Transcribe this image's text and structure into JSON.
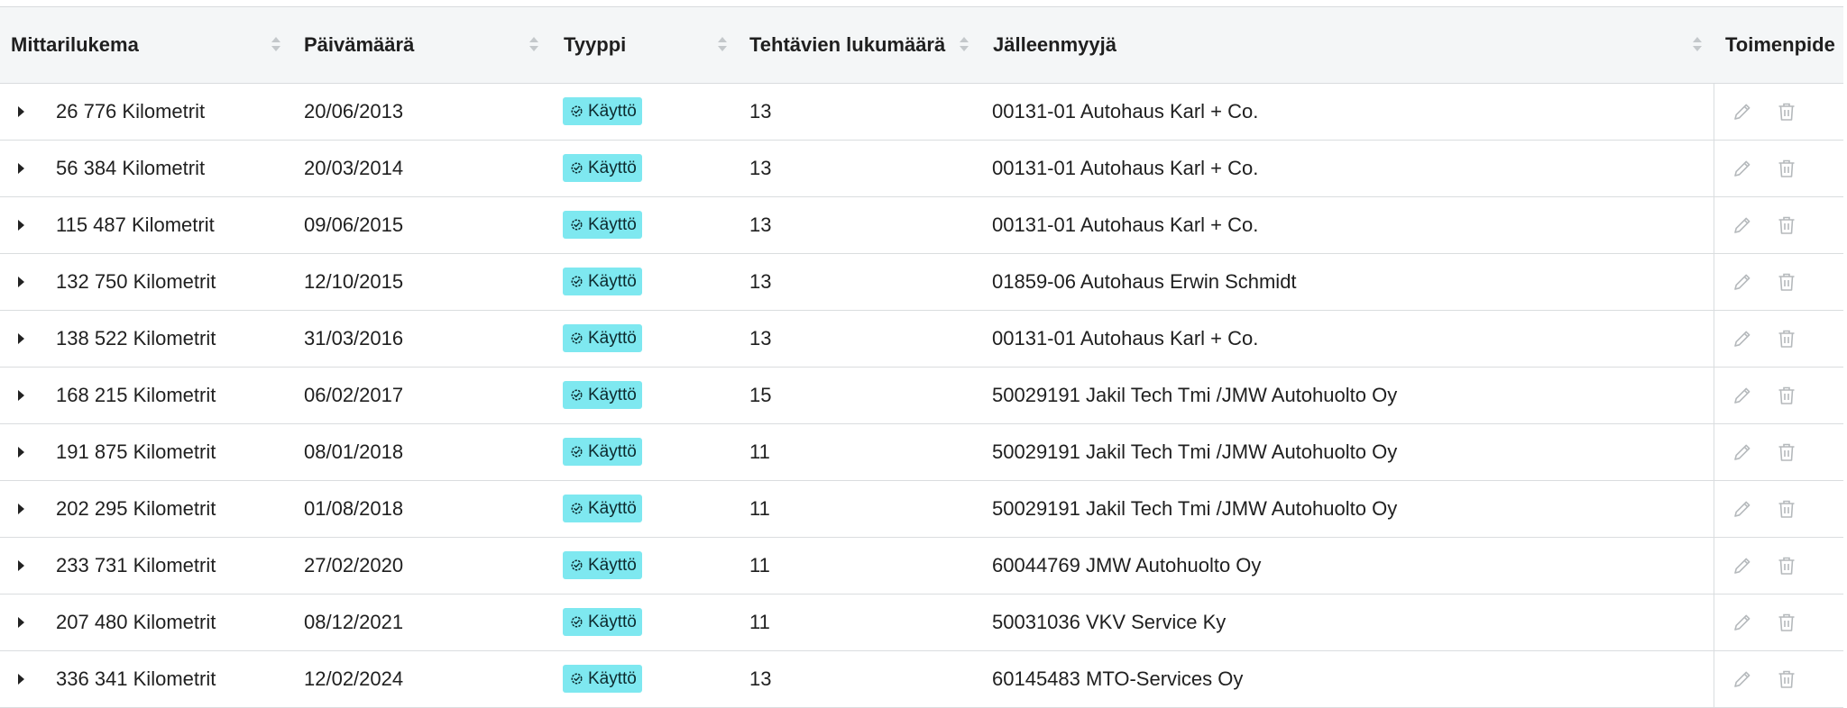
{
  "table": {
    "columns": [
      {
        "label": "Mittarilukema"
      },
      {
        "label": "Päivämäärä"
      },
      {
        "label": "Tyyppi"
      },
      {
        "label": "Tehtävien lukumäärä"
      },
      {
        "label": "Jälleenmyyjä"
      },
      {
        "label": "Toimenpide"
      }
    ],
    "rows": [
      {
        "mileage": "26 776 Kilometrit",
        "date": "20/06/2013",
        "type": "Käyttö",
        "tasks": "13",
        "dealer": "00131-01 Autohaus Karl + Co."
      },
      {
        "mileage": "56 384 Kilometrit",
        "date": "20/03/2014",
        "type": "Käyttö",
        "tasks": "13",
        "dealer": "00131-01 Autohaus Karl + Co."
      },
      {
        "mileage": "115 487 Kilometrit",
        "date": "09/06/2015",
        "type": "Käyttö",
        "tasks": "13",
        "dealer": "00131-01 Autohaus Karl + Co."
      },
      {
        "mileage": "132 750 Kilometrit",
        "date": "12/10/2015",
        "type": "Käyttö",
        "tasks": "13",
        "dealer": "01859-06 Autohaus Erwin Schmidt"
      },
      {
        "mileage": "138 522 Kilometrit",
        "date": "31/03/2016",
        "type": "Käyttö",
        "tasks": "13",
        "dealer": "00131-01 Autohaus Karl + Co."
      },
      {
        "mileage": "168 215 Kilometrit",
        "date": "06/02/2017",
        "type": "Käyttö",
        "tasks": "15",
        "dealer": "50029191 Jakil Tech Tmi /JMW Autohuolto Oy"
      },
      {
        "mileage": "191 875 Kilometrit",
        "date": "08/01/2018",
        "type": "Käyttö",
        "tasks": "11",
        "dealer": "50029191 Jakil Tech Tmi /JMW Autohuolto Oy"
      },
      {
        "mileage": "202 295 Kilometrit",
        "date": "01/08/2018",
        "type": "Käyttö",
        "tasks": "11",
        "dealer": "50029191 Jakil Tech Tmi /JMW Autohuolto Oy"
      },
      {
        "mileage": "233 731 Kilometrit",
        "date": "27/02/2020",
        "type": "Käyttö",
        "tasks": "11",
        "dealer": "60044769 JMW Autohuolto Oy"
      },
      {
        "mileage": "207 480 Kilometrit",
        "date": "08/12/2021",
        "type": "Käyttö",
        "tasks": "11",
        "dealer": "50031036 VKV Service Ky"
      },
      {
        "mileage": "336 341 Kilometrit",
        "date": "12/02/2024",
        "type": "Käyttö",
        "tasks": "13",
        "dealer": "60145483 MTO-Services Oy"
      }
    ]
  },
  "icons": {
    "sort": "sort-icon",
    "expand": "caret-right-icon",
    "type_badge": "gear-badge-icon",
    "edit": "pencil-icon",
    "delete": "trash-icon"
  },
  "colors": {
    "badge_bg": "#7ee8f0",
    "header_bg": "#f4f6f7",
    "action_icon": "#b5b9bc"
  }
}
